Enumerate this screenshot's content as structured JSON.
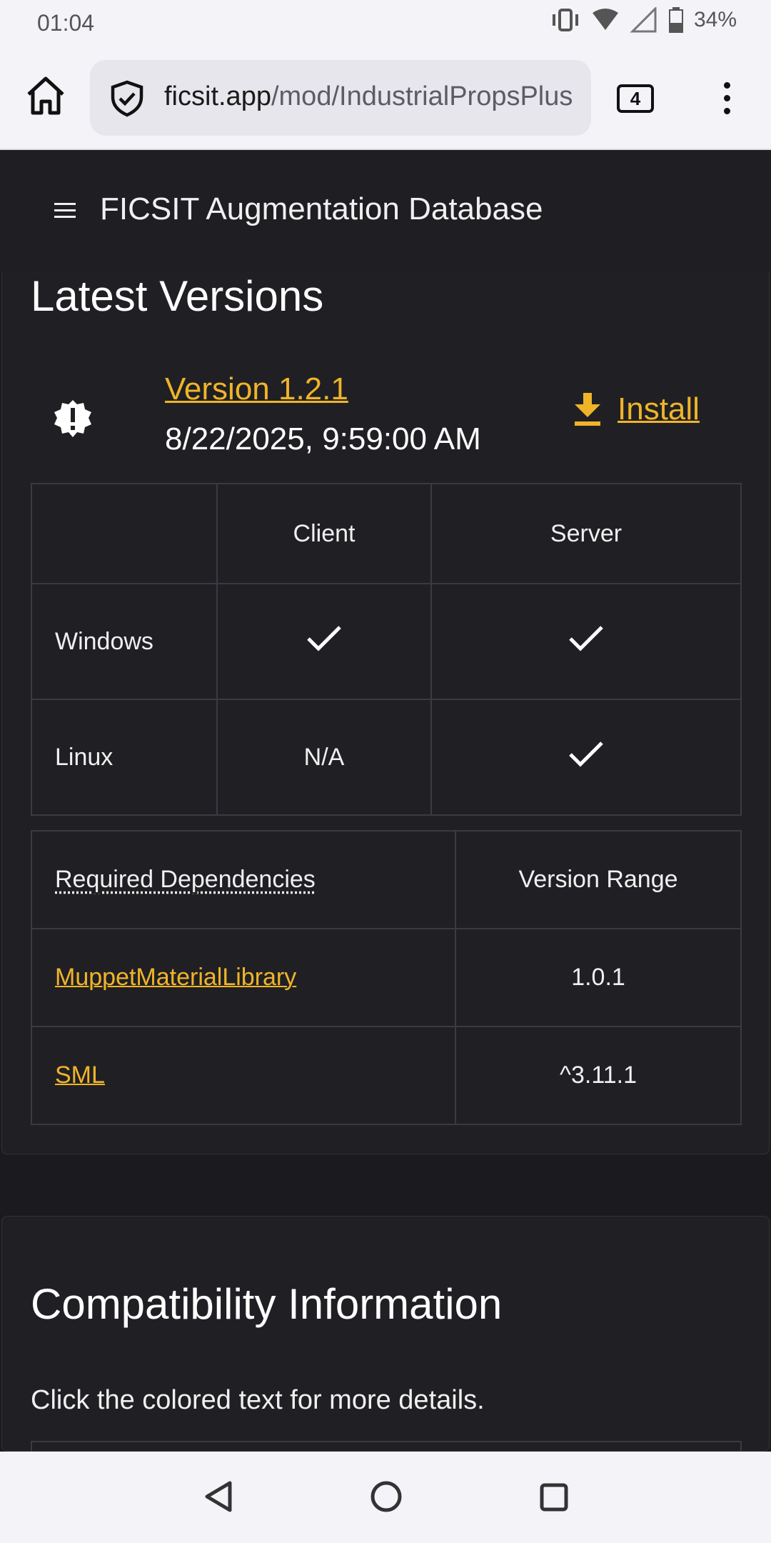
{
  "status_bar": {
    "time": "01:04",
    "battery": "34%"
  },
  "browser": {
    "url_domain": "ficsit.app",
    "url_path": "/mod/IndustrialPropsPlus",
    "tab_count": "4"
  },
  "app_header": {
    "title": "FICSIT Augmentation Database"
  },
  "latest_versions": {
    "heading": "Latest Versions",
    "version_label": "Version 1.2.1",
    "date": "8/22/2025, 9:59:00 AM",
    "install_label": "Install",
    "platforms": {
      "headers": [
        "",
        "Client",
        "Server"
      ],
      "rows": [
        {
          "label": "Windows",
          "client": "check",
          "server": "check"
        },
        {
          "label": "Linux",
          "client": "N/A",
          "server": "check"
        }
      ]
    },
    "dependencies": {
      "header_name": "Required Dependencies",
      "header_range": "Version Range",
      "rows": [
        {
          "name": "MuppetMaterialLibrary",
          "range": "1.0.1"
        },
        {
          "name": "SML",
          "range": "^3.11.1"
        }
      ]
    }
  },
  "compatibility": {
    "heading": "Compatibility Information",
    "note": "Click the colored text for more details."
  },
  "colors": {
    "accent": "#f0b429",
    "background": "#1b1b1f",
    "card": "#202024"
  }
}
